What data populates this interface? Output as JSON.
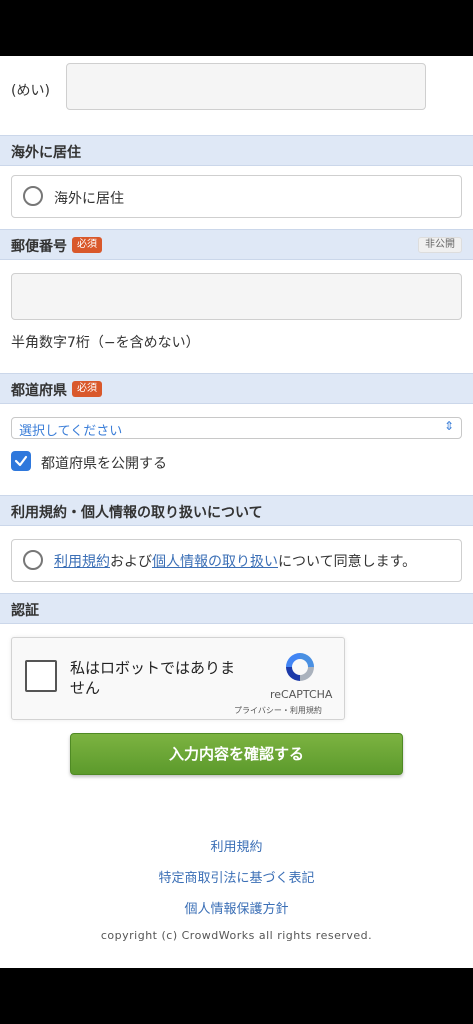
{
  "form": {
    "mei_label": "(めい)",
    "mei_value": "",
    "overseas": {
      "section_title": "海外に居住",
      "checkbox_label": "海外に居住"
    },
    "postal": {
      "section_title": "郵便番号",
      "required_badge": "必須",
      "private_badge": "非公開",
      "value": "",
      "hint": "半角数字7桁（−を含めない）"
    },
    "prefecture": {
      "section_title": "都道府県",
      "required_badge": "必須",
      "select_value": "選択してください",
      "publish_label": "都道府県を公開する",
      "publish_checked": true
    },
    "terms": {
      "section_title": "利用規約・個人情報の取り扱いについて",
      "link_terms": "利用規約",
      "text_and": "および",
      "link_privacy": "個人情報の取り扱い",
      "text_agree": "について同意します。"
    },
    "auth": {
      "section_title": "認証",
      "captcha_text": "私はロボットではありません",
      "captcha_brand": "reCAPTCHA",
      "captcha_terms": "プライバシー・利用規約"
    },
    "submit_label": "入力内容を確認する"
  },
  "footer": {
    "links": [
      "利用規約",
      "特定商取引法に基づく表記",
      "個人情報保護方針"
    ],
    "copyright": "copyright (c) CrowdWorks all rights reserved."
  },
  "colors": {
    "section_bg": "#dfe8f6",
    "required_badge": "#d9582b",
    "link": "#3b6fb6",
    "submit": "#6aa534",
    "checkbox_checked": "#2f78dc"
  }
}
